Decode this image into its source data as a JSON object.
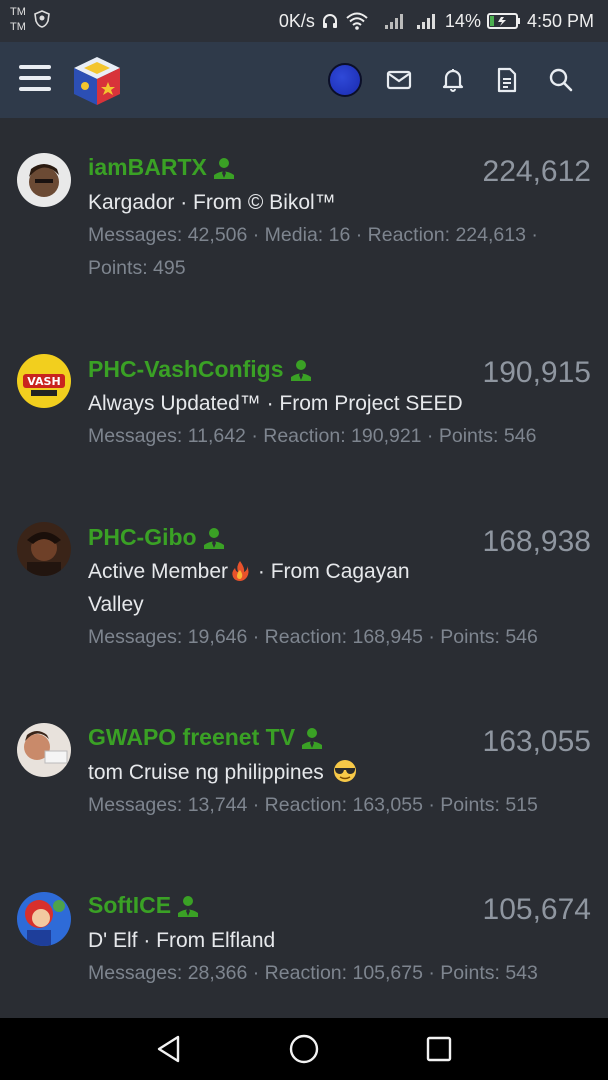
{
  "status_bar": {
    "carrier_1": "TM",
    "carrier_2": "TM",
    "net_speed": "0K/s",
    "battery": "14%",
    "time": "4:50 PM"
  },
  "app_bar": {
    "icons": [
      "menu-icon",
      "site-logo",
      "user-avatar",
      "mail-icon",
      "bell-icon",
      "document-icon",
      "search-icon"
    ]
  },
  "members": [
    {
      "name": "iamBARTX",
      "score": "224,612",
      "title": "Kargador · From © Bikol™",
      "stats": "Messages: 42,506 · Media: 16 · Reaction: 224,613 · Points: 495"
    },
    {
      "name": "PHC-VashConfigs",
      "score": "190,915",
      "title": "Always Updated™ · From Project SEED",
      "stats": "Messages: 11,642 · Reaction: 190,921 · Points: 546"
    },
    {
      "name": "PHC-Gibo",
      "score": "168,938",
      "title_part1": "Active Member",
      "title_part2": " · From Cagayan Valley",
      "stats": "Messages: 19,646 · Reaction: 168,945 · Points: 546"
    },
    {
      "name": "GWAPO freenet TV",
      "score": "163,055",
      "title": "tom Cruise ng philippines",
      "stats": "Messages: 13,744 · Reaction: 163,055 · Points: 515"
    },
    {
      "name": "SoftICE",
      "score": "105,674",
      "title": "D' Elf · From Elfland",
      "stats": "Messages: 28,366 · Reaction: 105,675 · Points: 543"
    }
  ],
  "colors": {
    "background": "#2a2d33",
    "app_bar": "#2f3a4a",
    "username_green": "#3aa125",
    "score_gray": "#8f96a0"
  }
}
